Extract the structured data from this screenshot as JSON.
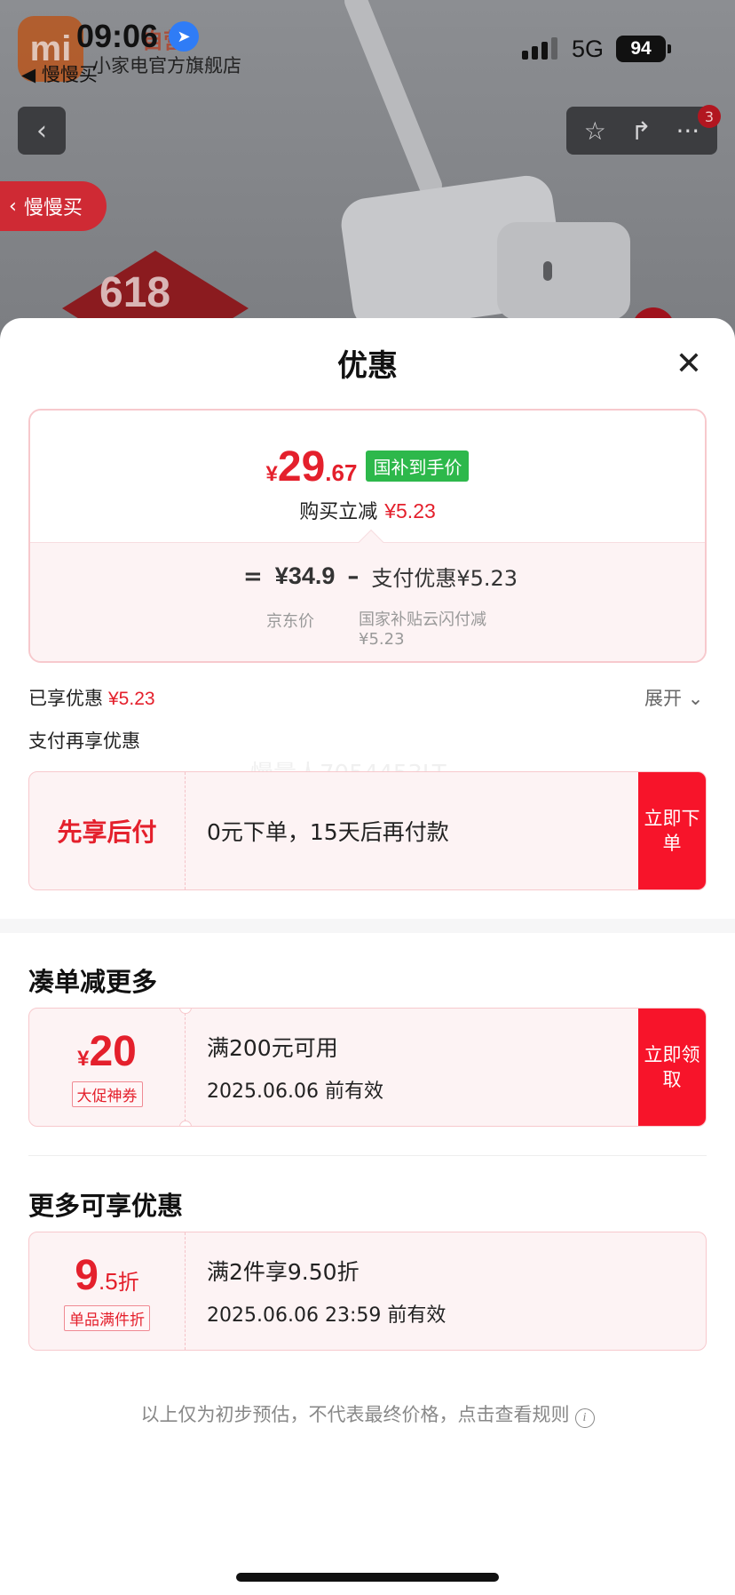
{
  "status_bar": {
    "time": "09:06",
    "network": "5G",
    "battery": "94",
    "back_app": "◀ 慢慢买"
  },
  "store": {
    "tag": "自营",
    "name": "小家电官方旗舰店",
    "logo": "mi"
  },
  "nav": {
    "cart_count": "3",
    "slow_buy_label": "慢慢买"
  },
  "background": {
    "promo_badge": "618"
  },
  "sheet": {
    "title": "优惠",
    "price": {
      "currency": "¥",
      "integer": "29",
      "decimal": ".67",
      "tag": "国补到手价",
      "reduce_label": "购买立减",
      "reduce_value": "¥5.23",
      "formula": {
        "eq": "=",
        "jd_price": "¥34.9",
        "minus": "–",
        "pay_discount": "支付优惠¥5.23",
        "jd_label": "京东价",
        "pay_discount_label": "国家补贴云闪付减¥5.23"
      }
    },
    "enjoyed": {
      "label": "已享优惠",
      "value": "¥5.23",
      "expand": "展开"
    },
    "pay_more_label": "支付再享优惠",
    "watermark": "慢量人7054453LT",
    "bnpl": {
      "title": "先享后付",
      "desc": "0元下单，15天后再付款",
      "action": "立即下单"
    },
    "bundle": {
      "section_title": "凑单减更多",
      "currency": "¥",
      "amount": "20",
      "tag": "大促神券",
      "condition": "满200元可用",
      "validity": "2025.06.06 前有效",
      "action": "立即领取"
    },
    "more": {
      "section_title": "更多可享优惠",
      "discount_int": "9",
      "discount_dec": ".5",
      "discount_unit": "折",
      "tag": "单品满件折",
      "condition": "满2件享9.50折",
      "validity": "2025.06.06 23:59 前有效"
    },
    "disclaimer": "以上仅为初步预估，不代表最终价格，点击查看规则"
  },
  "colors": {
    "accent": "#e4202c",
    "action": "#f7142a",
    "subsidy_green": "#2db84b",
    "card_bg": "#fdf3f4"
  }
}
